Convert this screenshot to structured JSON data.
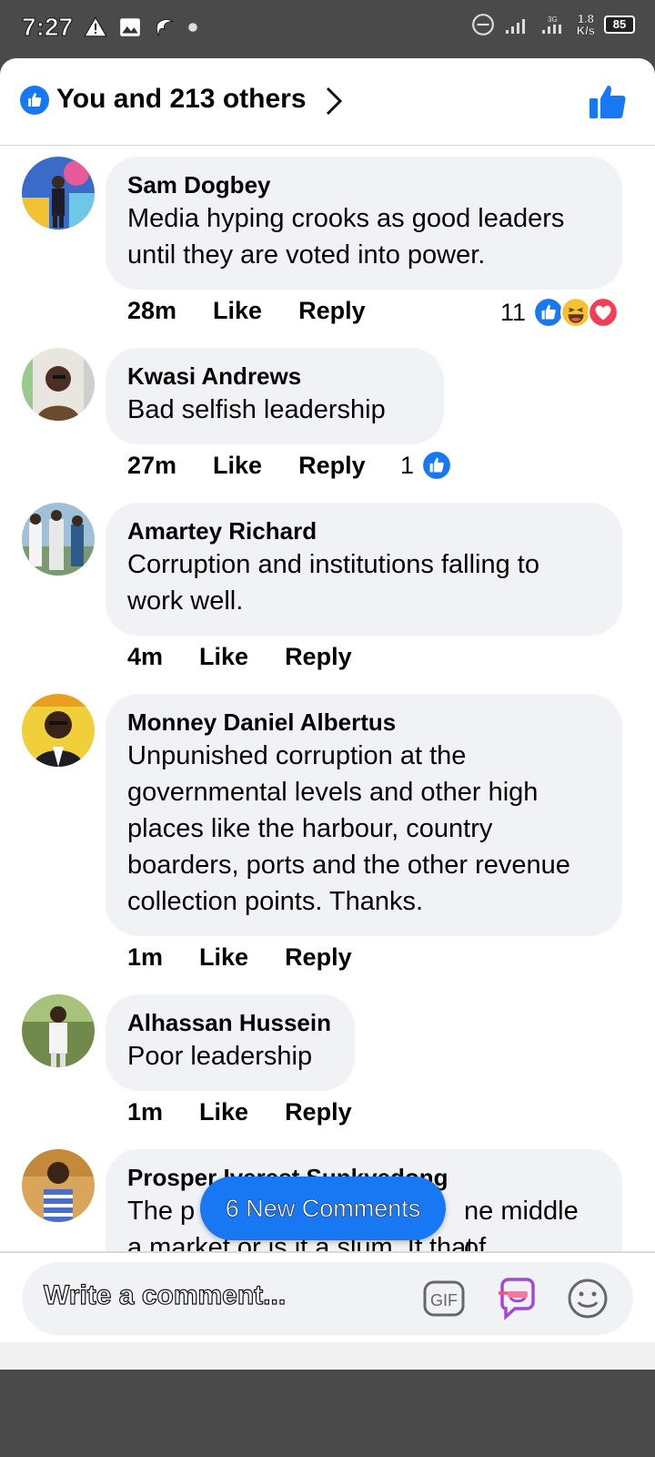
{
  "status_bar": {
    "time": "7:27",
    "net_type": "3G",
    "net_speed_value": "1.8",
    "net_speed_unit": "K/s",
    "battery": "85"
  },
  "reactions_header": {
    "text": "You and 213 others"
  },
  "comments": [
    {
      "author": "Sam Dogbey",
      "text": "Media hyping crooks as good leaders until they are voted into power.",
      "time": "28m",
      "like_label": "Like",
      "reply_label": "Reply",
      "reaction_count": "11",
      "reactions": [
        "like-icon",
        "haha-icon",
        "love-icon"
      ]
    },
    {
      "author": "Kwasi Andrews",
      "text": "Bad selfish leadership",
      "time": "27m",
      "like_label": "Like",
      "reply_label": "Reply",
      "reaction_count": "1",
      "reactions": [
        "like-icon"
      ]
    },
    {
      "author": "Amartey Richard",
      "text": "Corruption and institutions falling to work well.",
      "time": "4m",
      "like_label": "Like",
      "reply_label": "Reply"
    },
    {
      "author": "Monney Daniel Albertus",
      "text": "Unpunished corruption at the governmental levels and other high places like the harbour, country boarders, ports and the other revenue collection points. Thanks.",
      "time": "1m",
      "like_label": "Like",
      "reply_label": "Reply"
    },
    {
      "author": "Alhassan Hussein",
      "text": "Poor leadership",
      "time": "1m",
      "like_label": "Like",
      "reply_label": "Reply"
    },
    {
      "author": "Prosper Iverest Sunkyedong",
      "text_line1_left": "The p",
      "text_line1_right": "ne middle of",
      "text_line2": "a market or is it a slum. If that"
    }
  ],
  "new_comments_pill": "6 New Comments",
  "composer": {
    "placeholder": "Write a comment...",
    "gif_label": "GIF"
  },
  "colors": {
    "facebook_blue": "#1877f2",
    "bubble_gray": "#f0f2f5",
    "status_bar": "#4a4a4a"
  }
}
